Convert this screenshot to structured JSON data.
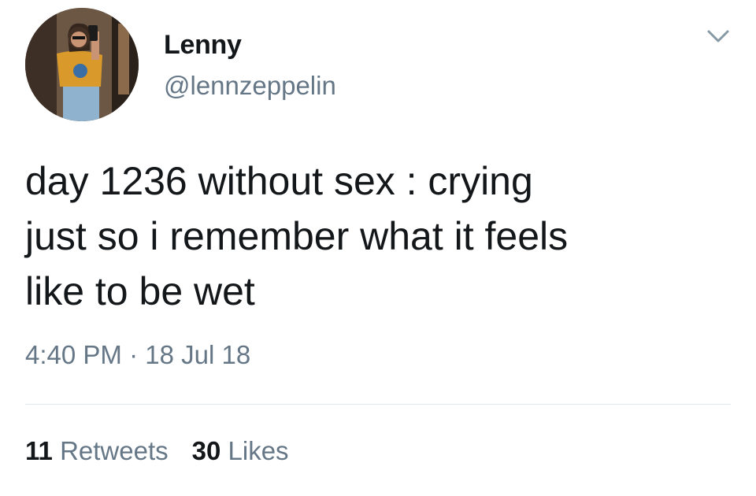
{
  "user": {
    "display_name": "Lenny",
    "handle": "@lennzeppelin",
    "avatar_alt": "profile photo"
  },
  "tweet": {
    "text_lines": [
      "day 1236 without sex : crying",
      "just so i remember what it feels",
      "like to be wet"
    ],
    "time": "4:40 PM",
    "separator": "·",
    "date": "18 Jul 18"
  },
  "stats": {
    "retweets_count": "11",
    "retweets_label": "Retweets",
    "likes_count": "30",
    "likes_label": "Likes"
  },
  "icons": {
    "menu": "chevron-down-icon"
  },
  "colors": {
    "text_primary": "#14171a",
    "text_secondary": "#657786",
    "divider": "#e1e8ed"
  }
}
